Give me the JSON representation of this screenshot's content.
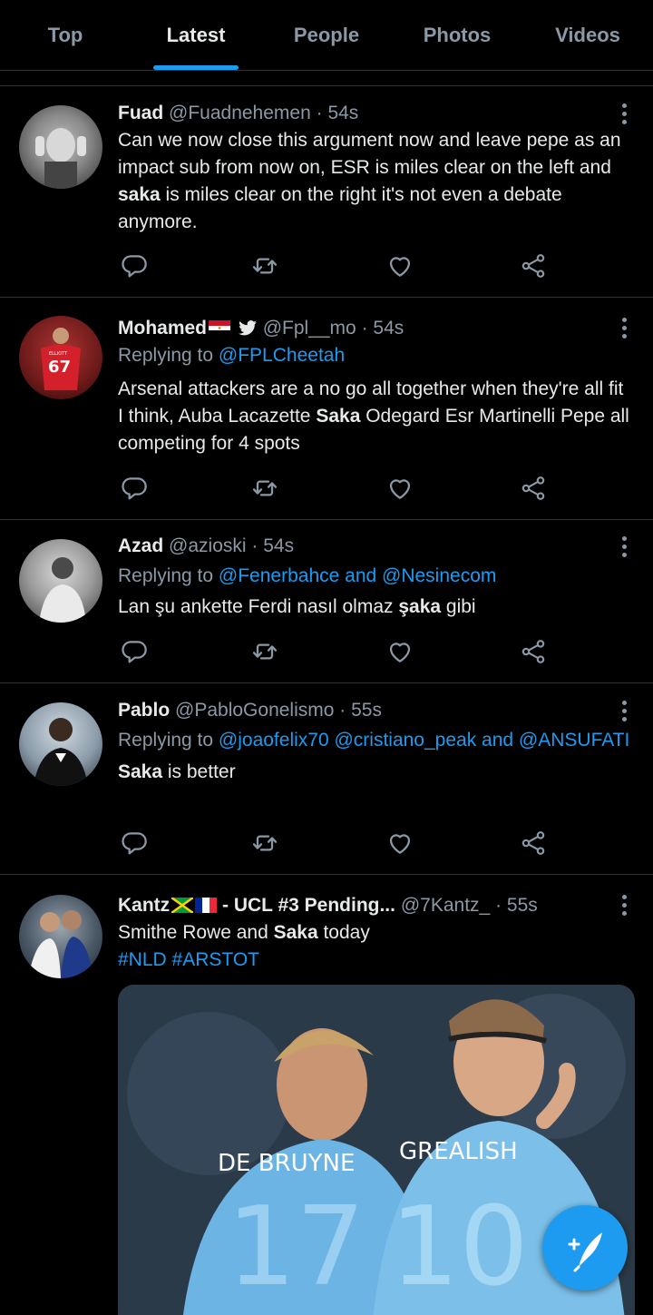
{
  "tabs": [
    {
      "label": "Top"
    },
    {
      "label": "Latest"
    },
    {
      "label": "People"
    },
    {
      "label": "Photos"
    },
    {
      "label": "Videos"
    }
  ],
  "active_tab": "Latest",
  "accent_color": "#1d9bf0",
  "tweets": [
    {
      "name": "Fuad",
      "handle": "@Fuadnehemen",
      "time": "· 54s",
      "text_parts": [
        "Can we now close this argument now and leave pepe as an impact sub from now on, ESR is miles clear on the left and ",
        "saka",
        " is miles clear on the right it's not even a debate anymore."
      ]
    },
    {
      "name": "Mohamed",
      "name_icons": [
        "egypt-flag-icon",
        "twitter-bird-icon"
      ],
      "handle": "@Fpl__mo",
      "time": "· 54s",
      "reply_prefix": "Replying to",
      "reply_mentions": "@FPLCheetah",
      "avatar_number": "67",
      "avatar_jersey_name": "ELLIOTT",
      "text_parts": [
        "Arsenal attackers are a no go all together when they're all fit I think, Auba Lacazette ",
        "Saka",
        " Odegard Esr Martinelli Pepe all competing for 4 spots"
      ]
    },
    {
      "name": "Azad",
      "handle": "@azioski",
      "time": "· 54s",
      "reply_prefix": "Replying to",
      "reply_mentions": "@Fenerbahce and @Nesinecom",
      "text_parts": [
        "Lan şu ankette Ferdi nasıl olmaz ",
        "şaka",
        " gibi"
      ]
    },
    {
      "name": "Pablo",
      "handle": "@PabloGonelismo",
      "time": "· 55s",
      "reply_prefix": "Replying to",
      "reply_mentions": "@joaofelix70 @cristiano_peak and @ANSUFATI",
      "text_parts": [
        "",
        "Saka",
        " is better"
      ]
    },
    {
      "name": "Kantz",
      "name_icons": [
        "jamaica-flag-icon",
        "france-flag-icon"
      ],
      "name_suffix": " - UCL #3 Pending...",
      "handle": "@7Kantz_",
      "time": "· 55s",
      "text_parts": [
        "Smithe Rowe and ",
        "Saka",
        " today"
      ],
      "hashtags": "#NLD #ARSTOT",
      "media_jersey_left": "DE BRUYNE",
      "media_number_left": "17",
      "media_jersey_right": "GREALISH",
      "media_number_right": "10"
    }
  ],
  "actions": [
    "reply-icon",
    "retweet-icon",
    "like-icon",
    "share-icon"
  ],
  "compose_button": "compose-tweet-icon"
}
